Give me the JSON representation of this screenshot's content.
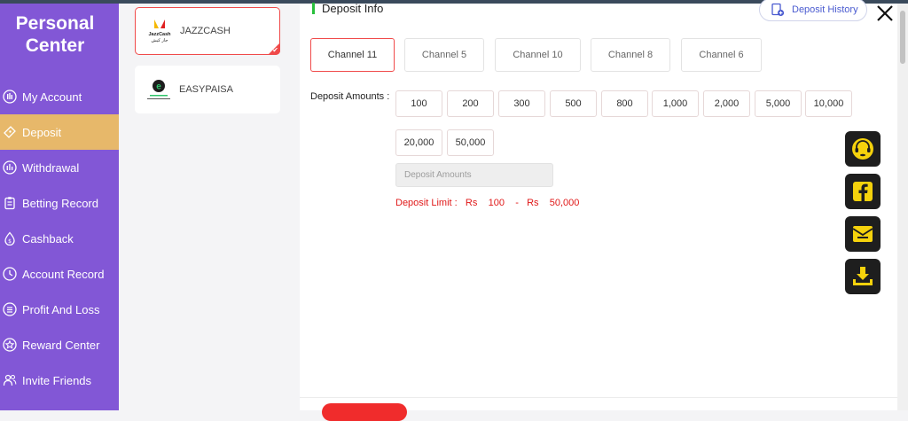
{
  "sidebar": {
    "title_line1": "Personal",
    "title_line2": "Center",
    "items": [
      {
        "label": "My Account",
        "icon": "user-circle-icon"
      },
      {
        "label": "Deposit",
        "icon": "ticket-icon",
        "active": true
      },
      {
        "label": "Withdrawal",
        "icon": "chart-circle-icon"
      },
      {
        "label": "Betting Record",
        "icon": "clipboard-icon"
      },
      {
        "label": "Cashback",
        "icon": "coin-drop-icon"
      },
      {
        "label": "Account Record",
        "icon": "clock-circle-icon"
      },
      {
        "label": "Profit And Loss",
        "icon": "list-circle-icon"
      },
      {
        "label": "Reward Center",
        "icon": "star-badge-icon"
      },
      {
        "label": "Invite Friends",
        "icon": "users-icon"
      }
    ]
  },
  "channels": {
    "items": [
      {
        "name": "JAZZCASH",
        "logo_top": "JazzCash",
        "logo_bottom": "جاز کیش",
        "active": true
      },
      {
        "name": "EASYPAISA",
        "logo_top": "e",
        "active": false
      }
    ]
  },
  "deposit": {
    "section_title": "Deposit Info",
    "history_label": "Deposit History",
    "tabs": [
      "Channel 11",
      "Channel 5",
      "Channel 10",
      "Channel 8",
      "Channel 6"
    ],
    "active_tab": "Channel 11",
    "amounts_label": "Deposit Amounts :",
    "amounts": [
      "100",
      "200",
      "300",
      "500",
      "800",
      "1,000",
      "2,000",
      "5,000",
      "10,000",
      "20,000",
      "50,000"
    ],
    "input_placeholder": "Deposit Amounts",
    "limit_prefix": "Deposit Limit :",
    "limit_currency": "Rs",
    "limit_min": "100",
    "limit_separator": "-",
    "limit_max": "50,000"
  },
  "floating": [
    "headset-icon",
    "facebook-icon",
    "mail-icon",
    "download-icon"
  ],
  "colors": {
    "sidebar_bg": "#8257d6",
    "active_nav": "#e7b86a",
    "accent_red": "#f04a4a",
    "green_marker": "#28c03c",
    "history_blue": "#4a5bd0",
    "float_yellow": "#f5d20c"
  }
}
